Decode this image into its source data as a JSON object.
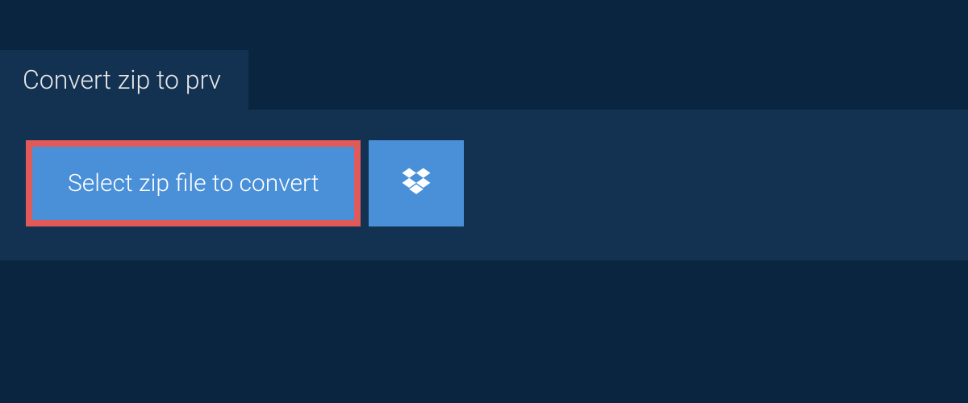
{
  "tab": {
    "label": "Convert zip to prv"
  },
  "actions": {
    "select_label": "Select zip file to convert"
  }
}
